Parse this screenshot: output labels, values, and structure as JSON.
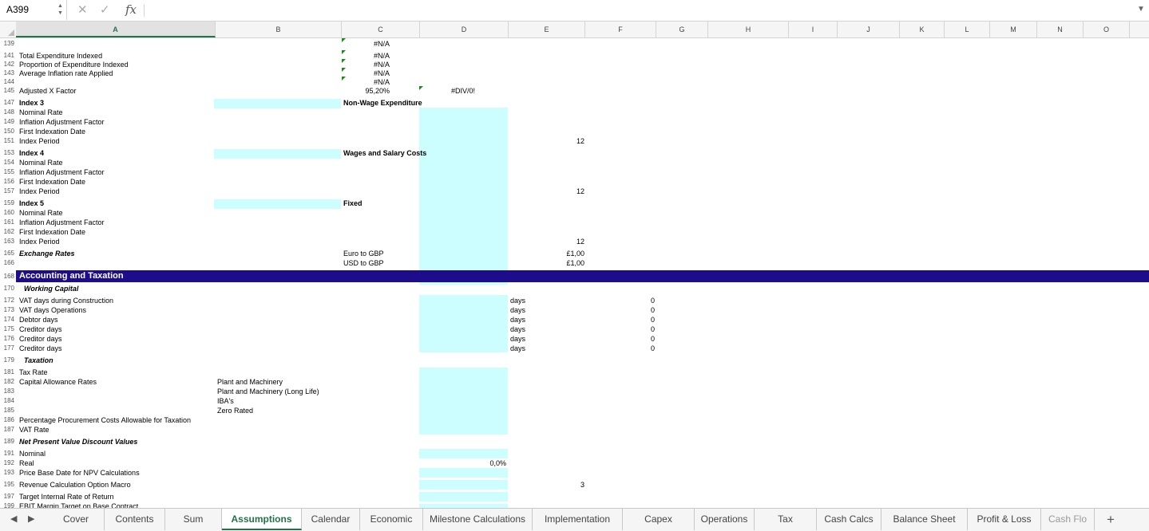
{
  "formula_bar": {
    "name_box": "A399",
    "fx": "fx",
    "formula": ""
  },
  "columns": [
    "A",
    "B",
    "C",
    "D",
    "E",
    "F",
    "G",
    "H",
    "I",
    "J",
    "K",
    "L",
    "M",
    "N",
    "O"
  ],
  "rows": [
    {
      "n": "139",
      "cells": [
        {
          "c": "C",
          "t": "#N/A"
        }
      ]
    },
    {
      "n": "141",
      "cells": [
        {
          "c": "A",
          "t": "Total Expenditure Indexed"
        },
        {
          "c": "C",
          "t": "#N/A"
        }
      ]
    },
    {
      "n": "142",
      "cells": [
        {
          "c": "A",
          "t": "Proportion of Expenditure Indexed"
        },
        {
          "c": "C",
          "t": "#N/A"
        }
      ]
    },
    {
      "n": "143",
      "cells": [
        {
          "c": "A",
          "t": "Average Inflation rate Applied"
        },
        {
          "c": "C",
          "t": "#N/A"
        }
      ]
    },
    {
      "n": "144",
      "cells": [
        {
          "c": "C",
          "t": "#N/A"
        }
      ]
    },
    {
      "n": "145",
      "cells": [
        {
          "c": "A",
          "t": "Adjusted X Factor"
        },
        {
          "c": "C",
          "t": "95,20%"
        },
        {
          "c": "D",
          "t": "#DIV/0!"
        }
      ]
    },
    {
      "n": "147",
      "cells": [
        {
          "c": "A",
          "t": "Index 3",
          "s": "b"
        },
        {
          "c": "C",
          "t": "Non-Wage Expenditure",
          "s": "b"
        }
      ]
    },
    {
      "n": "148",
      "cells": [
        {
          "c": "A",
          "t": "Nominal Rate"
        }
      ]
    },
    {
      "n": "149",
      "cells": [
        {
          "c": "A",
          "t": "Inflation Adjustment Factor"
        }
      ]
    },
    {
      "n": "150",
      "cells": [
        {
          "c": "A",
          "t": "First Indexation Date"
        }
      ]
    },
    {
      "n": "151",
      "cells": [
        {
          "c": "A",
          "t": "Index Period"
        },
        {
          "c": "E",
          "t": "12"
        }
      ]
    },
    {
      "n": "153",
      "cells": [
        {
          "c": "A",
          "t": "Index 4",
          "s": "b"
        },
        {
          "c": "C",
          "t": "Wages and Salary Costs",
          "s": "b"
        }
      ]
    },
    {
      "n": "154",
      "cells": [
        {
          "c": "A",
          "t": "Nominal Rate"
        }
      ]
    },
    {
      "n": "155",
      "cells": [
        {
          "c": "A",
          "t": "Inflation Adjustment Factor"
        }
      ]
    },
    {
      "n": "156",
      "cells": [
        {
          "c": "A",
          "t": "First Indexation Date"
        }
      ]
    },
    {
      "n": "157",
      "cells": [
        {
          "c": "A",
          "t": "Index Period"
        },
        {
          "c": "E",
          "t": "12"
        }
      ]
    },
    {
      "n": "159",
      "cells": [
        {
          "c": "A",
          "t": "Index 5",
          "s": "b"
        },
        {
          "c": "C",
          "t": "Fixed",
          "s": "b"
        }
      ]
    },
    {
      "n": "160",
      "cells": [
        {
          "c": "A",
          "t": "Nominal Rate"
        }
      ]
    },
    {
      "n": "161",
      "cells": [
        {
          "c": "A",
          "t": "Inflation Adjustment Factor"
        }
      ]
    },
    {
      "n": "162",
      "cells": [
        {
          "c": "A",
          "t": "First Indexation Date"
        }
      ]
    },
    {
      "n": "163",
      "cells": [
        {
          "c": "A",
          "t": "Index Period"
        },
        {
          "c": "E",
          "t": "12"
        }
      ]
    },
    {
      "n": "165",
      "cells": [
        {
          "c": "A",
          "t": "Exchange Rates",
          "s": "bi"
        },
        {
          "c": "C",
          "t": "Euro to GBP"
        },
        {
          "c": "E",
          "t": "£1,00"
        }
      ]
    },
    {
      "n": "166",
      "cells": [
        {
          "c": "C",
          "t": "USD to GBP"
        },
        {
          "c": "E",
          "t": "£1,00"
        }
      ]
    },
    {
      "n": "168",
      "cells": []
    },
    {
      "n": "170",
      "cells": [
        {
          "c": "A",
          "t": "Working Capital",
          "s": "bi",
          "ind": true
        }
      ]
    },
    {
      "n": "172",
      "cells": [
        {
          "c": "A",
          "t": "VAT days during Construction"
        },
        {
          "c": "D2",
          "t": "days"
        },
        {
          "c": "F",
          "t": "0"
        }
      ]
    },
    {
      "n": "173",
      "cells": [
        {
          "c": "A",
          "t": "VAT days Operations"
        },
        {
          "c": "D2",
          "t": "days"
        },
        {
          "c": "F",
          "t": "0"
        }
      ]
    },
    {
      "n": "174",
      "cells": [
        {
          "c": "A",
          "t": "Debtor days"
        },
        {
          "c": "D2",
          "t": "days"
        },
        {
          "c": "F",
          "t": "0"
        }
      ]
    },
    {
      "n": "175",
      "cells": [
        {
          "c": "A",
          "t": "Creditor days"
        },
        {
          "c": "D2",
          "t": "days"
        },
        {
          "c": "F",
          "t": "0"
        }
      ]
    },
    {
      "n": "176",
      "cells": [
        {
          "c": "A",
          "t": "Creditor days"
        },
        {
          "c": "D2",
          "t": "days"
        },
        {
          "c": "F",
          "t": "0"
        }
      ]
    },
    {
      "n": "177",
      "cells": [
        {
          "c": "A",
          "t": "Creditor days"
        },
        {
          "c": "D2",
          "t": "days"
        },
        {
          "c": "F",
          "t": "0"
        }
      ]
    },
    {
      "n": "179",
      "cells": [
        {
          "c": "A",
          "t": "Taxation",
          "s": "bi",
          "ind": true
        }
      ]
    },
    {
      "n": "181",
      "cells": [
        {
          "c": "A",
          "t": "Tax Rate"
        }
      ]
    },
    {
      "n": "182",
      "cells": [
        {
          "c": "A",
          "t": "Capital Allowance Rates"
        },
        {
          "c": "B",
          "t": "Plant and Machinery"
        }
      ]
    },
    {
      "n": "183",
      "cells": [
        {
          "c": "B",
          "t": "Plant and Machinery (Long Life)"
        }
      ]
    },
    {
      "n": "184",
      "cells": [
        {
          "c": "B",
          "t": "IBA's"
        }
      ]
    },
    {
      "n": "185",
      "cells": [
        {
          "c": "B",
          "t": "Zero Rated"
        }
      ]
    },
    {
      "n": "186",
      "cells": [
        {
          "c": "A",
          "t": "Percentage Procurement Costs Allowable for Taxation"
        }
      ]
    },
    {
      "n": "187",
      "cells": [
        {
          "c": "A",
          "t": "VAT Rate"
        }
      ]
    },
    {
      "n": "189",
      "cells": [
        {
          "c": "A",
          "t": "Net Present Value Discount Values",
          "s": "bi"
        }
      ]
    },
    {
      "n": "191",
      "cells": [
        {
          "c": "A",
          "t": "Nominal"
        }
      ]
    },
    {
      "n": "192",
      "cells": [
        {
          "c": "A",
          "t": "Real"
        },
        {
          "c": "D",
          "t": "0,0%"
        }
      ]
    },
    {
      "n": "193",
      "cells": [
        {
          "c": "A",
          "t": "Price Base Date for NPV Calculations"
        }
      ]
    },
    {
      "n": "195",
      "cells": [
        {
          "c": "A",
          "t": "Revenue Calculation Option Macro"
        },
        {
          "c": "E",
          "t": "3"
        }
      ]
    },
    {
      "n": "197",
      "cells": [
        {
          "c": "A",
          "t": "Target Internal Rate of Return"
        }
      ]
    },
    {
      "n": "199",
      "cells": [
        {
          "c": "A",
          "t": "EBIT Margin Target on Base Contract"
        }
      ]
    }
  ],
  "section_band": "Accounting and Taxation",
  "sheet_tabs": [
    "Cover",
    "Contents",
    "Sum",
    "Assumptions",
    "Calendar",
    "Economic",
    "Milestone Calculations",
    "Implementation",
    "Capex",
    "Operations",
    "Tax",
    "Cash Calcs",
    "Balance Sheet",
    "Profit & Loss",
    "Cash Flo"
  ],
  "active_tab": "Assumptions",
  "colors": {
    "input_fill": "#ccfdff",
    "band": "#1d0d8a",
    "accent": "#217346",
    "marker": "#1a8a1a"
  }
}
